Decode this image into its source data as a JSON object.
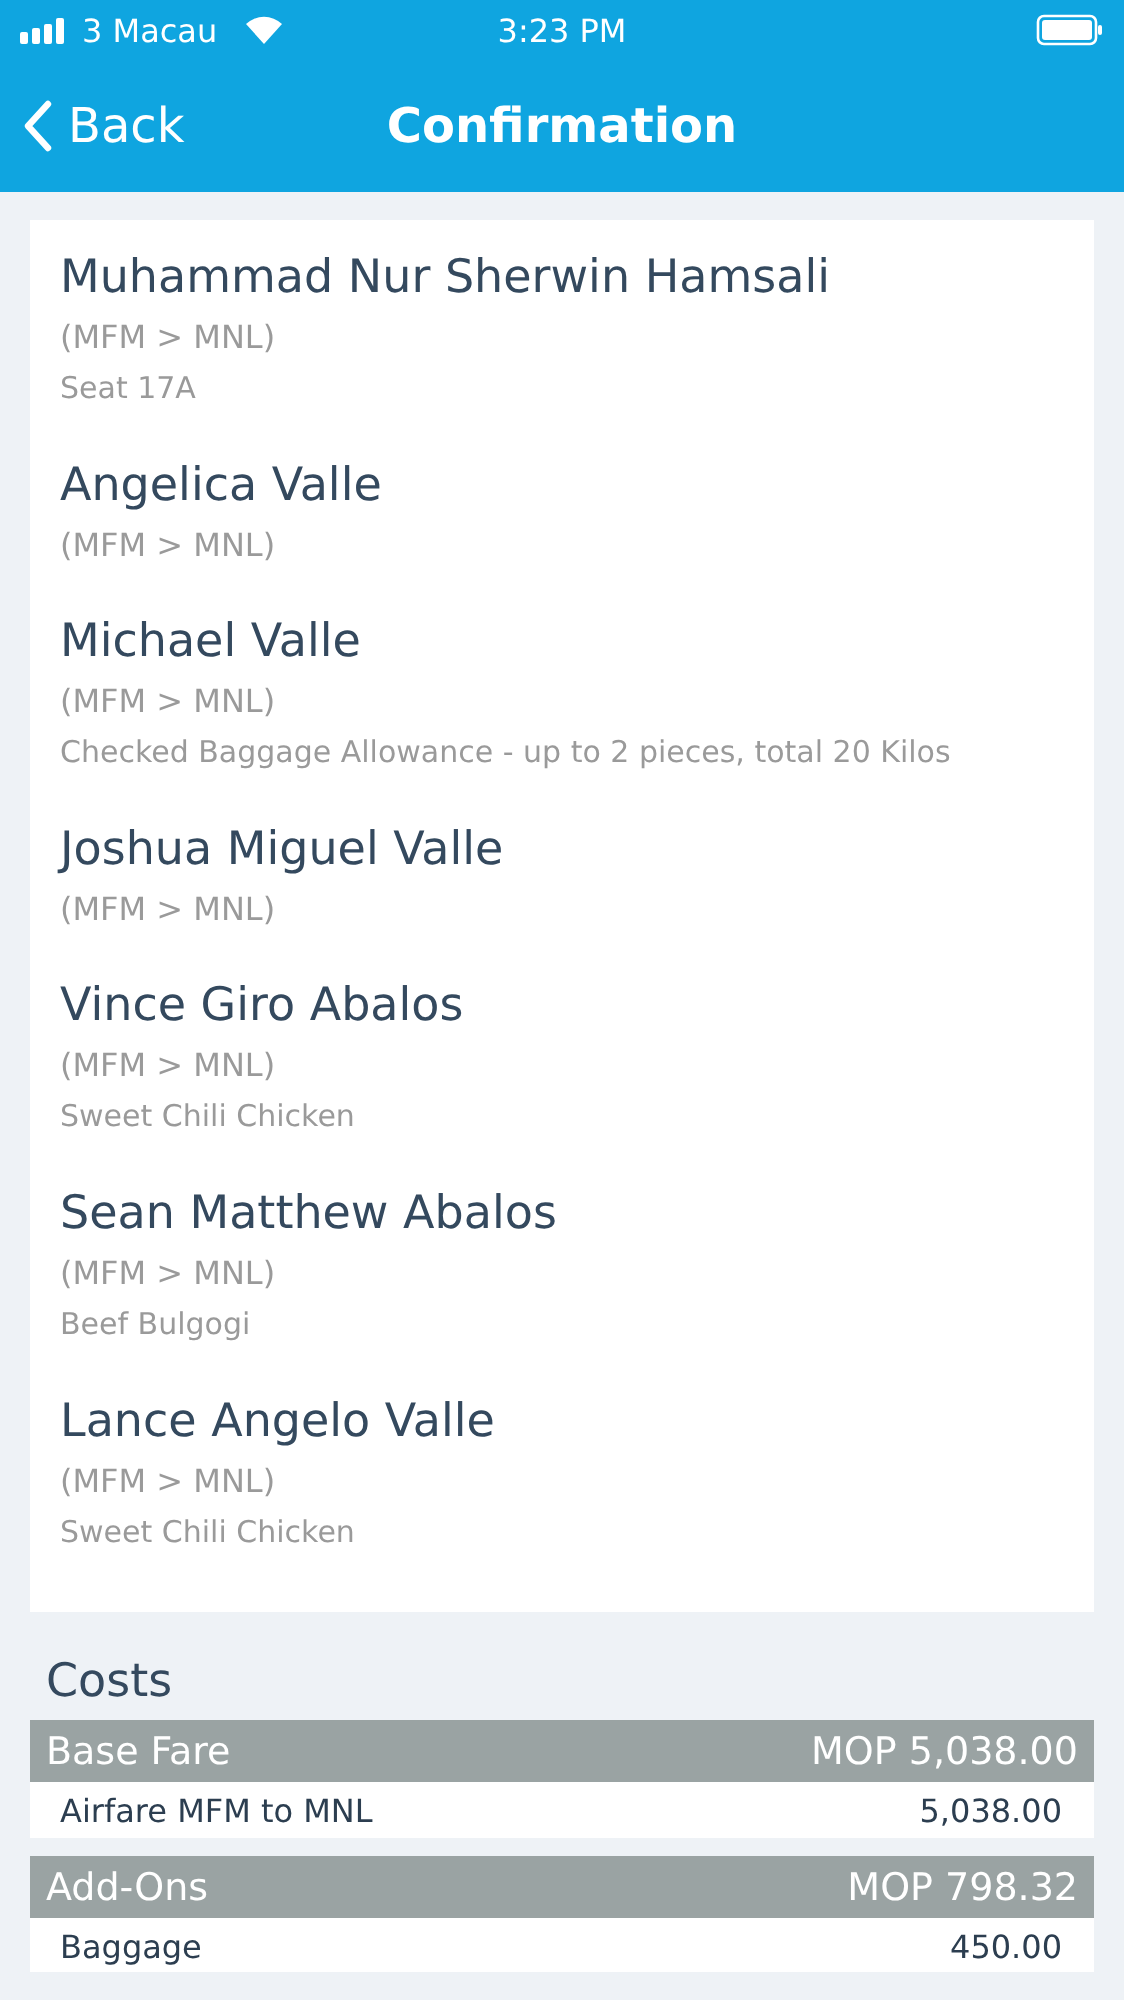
{
  "status_bar": {
    "carrier": "3 Macau",
    "time": "3:23 PM"
  },
  "nav": {
    "back": "Back",
    "title": "Confirmation"
  },
  "passengers": [
    {
      "name": "Muhammad Nur Sherwin Hamsali",
      "route": "(MFM > MNL)",
      "details": [
        "Seat 17A"
      ]
    },
    {
      "name": "Angelica Valle",
      "route": "(MFM > MNL)"
    },
    {
      "name": "Michael Valle",
      "route": "(MFM > MNL)",
      "details": [
        "Checked Baggage Allowance - up to 2 pieces, total 20 Kilos"
      ]
    },
    {
      "name": "Joshua Miguel Valle",
      "route": "(MFM > MNL)"
    },
    {
      "name": "Vince Giro Abalos",
      "route": "(MFM > MNL)",
      "details": [
        "Sweet Chili Chicken"
      ]
    },
    {
      "name": "Sean Matthew Abalos",
      "route": "(MFM > MNL)",
      "details": [
        "Beef Bulgogi"
      ]
    },
    {
      "name": "Lance Angelo Valle",
      "route": "(MFM > MNL)",
      "details": [
        "Sweet Chili Chicken"
      ]
    }
  ],
  "costs": {
    "title": "Costs",
    "groups": [
      {
        "label": "Base Fare",
        "total": "MOP 5,038.00",
        "items": [
          {
            "label": "Airfare MFM to MNL",
            "amount": "5,038.00"
          }
        ]
      },
      {
        "label": "Add-Ons",
        "total": "MOP 798.32",
        "items": [
          {
            "label": "Baggage",
            "amount": "450.00"
          }
        ]
      }
    ]
  }
}
